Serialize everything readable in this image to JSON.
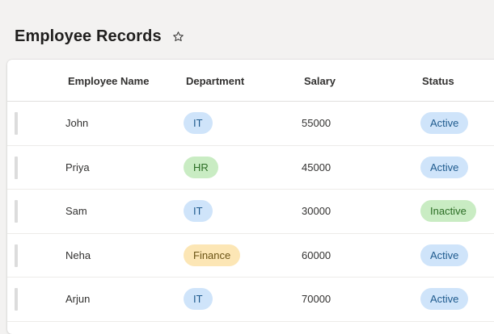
{
  "page": {
    "title": "Employee Records"
  },
  "table": {
    "headers": {
      "name": "Employee Name",
      "department": "Department",
      "salary": "Salary",
      "status": "Status"
    },
    "rows": [
      {
        "name": "John",
        "department": "IT",
        "department_color": "blue",
        "salary": "55000",
        "status": "Active",
        "status_color": "blue"
      },
      {
        "name": "Priya",
        "department": "HR",
        "department_color": "green",
        "salary": "45000",
        "status": "Active",
        "status_color": "blue"
      },
      {
        "name": "Sam",
        "department": "IT",
        "department_color": "blue",
        "salary": "30000",
        "status": "Inactive",
        "status_color": "green"
      },
      {
        "name": "Neha",
        "department": "Finance",
        "department_color": "yellow",
        "salary": "60000",
        "status": "Active",
        "status_color": "blue"
      },
      {
        "name": "Arjun",
        "department": "IT",
        "department_color": "blue",
        "salary": "70000",
        "status": "Active",
        "status_color": "blue"
      }
    ]
  },
  "colors": {
    "blue_pill_bg": "#cfe4fa",
    "green_pill_bg": "#c9ecc3",
    "yellow_pill_bg": "#fce6b5"
  },
  "icons": {
    "favorite": "star-outline-icon"
  }
}
